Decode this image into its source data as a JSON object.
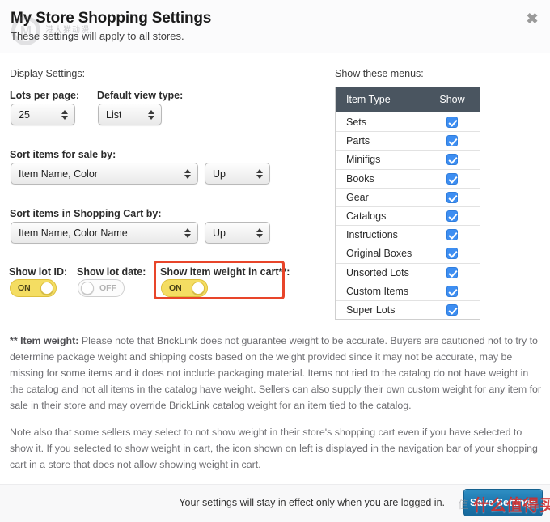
{
  "header": {
    "title": "My Store Shopping Settings",
    "subtitle": "These settings will apply to all stores.",
    "close_icon": "close-icon"
  },
  "watermarks": {
    "logo_letter": "M",
    "top_text": "港大猫动漫",
    "bottom_text": "什么值得买",
    "badge_text": "值"
  },
  "display": {
    "section_label": "Display Settings:",
    "lots_per_page": {
      "label": "Lots per page:",
      "value": "25"
    },
    "default_view_type": {
      "label": "Default view type:",
      "value": "List"
    }
  },
  "sort_for_sale": {
    "label": "Sort items for sale by:",
    "field_value": "Item Name, Color",
    "direction_value": "Up"
  },
  "sort_cart": {
    "label": "Sort items in Shopping Cart by:",
    "field_value": "Item Name, Color Name",
    "direction_value": "Up"
  },
  "toggles": [
    {
      "label": "Show lot ID:",
      "state": "ON",
      "on": true,
      "highlighted": false
    },
    {
      "label": "Show lot date:",
      "state": "OFF",
      "on": false,
      "highlighted": false
    },
    {
      "label": "Show item weight in cart**:",
      "state": "ON",
      "on": true,
      "highlighted": true
    }
  ],
  "menus": {
    "section_label": "Show these menus:",
    "columns": [
      "Item Type",
      "Show"
    ],
    "rows": [
      {
        "type": "Sets",
        "show": true
      },
      {
        "type": "Parts",
        "show": true
      },
      {
        "type": "Minifigs",
        "show": true
      },
      {
        "type": "Books",
        "show": true
      },
      {
        "type": "Gear",
        "show": true
      },
      {
        "type": "Catalogs",
        "show": true
      },
      {
        "type": "Instructions",
        "show": true
      },
      {
        "type": "Original Boxes",
        "show": true
      },
      {
        "type": "Unsorted Lots",
        "show": true
      },
      {
        "type": "Custom Items",
        "show": true
      },
      {
        "type": "Super Lots",
        "show": true
      }
    ]
  },
  "notes": {
    "weight_note_lead": "** Item weight:",
    "weight_note_body": " Please note that BrickLink does not guarantee weight to be accurate. Buyers are cautioned not to try to determine package weight and shipping costs based on the weight provided since it may not be accurate, may be missing for some items and it does not include packaging material. Items not tied to the catalog do not have weight in the catalog and not all items in the catalog have weight. Sellers can also supply their own custom weight for any item for sale in their store and may override BrickLink catalog weight for an item tied to the catalog.",
    "second_note": "Note also that some sellers may select to not show weight in their store's shopping cart even if you have selected to show it. If you selected to show weight in cart, the icon shown on left is displayed in the navigation bar of your shopping cart in a store that does not allow showing weight in cart."
  },
  "footer": {
    "note": "Your settings will stay in effect only when you are logged in.",
    "save_label": "Save Settings"
  },
  "colors": {
    "table_header": "#4a5560",
    "checkbox": "#3d8ef2",
    "toggle_on": "#f4dd62",
    "highlight_border": "#e8452a",
    "save_button": "#1b76ad",
    "watermark_red": "#cd2828"
  }
}
